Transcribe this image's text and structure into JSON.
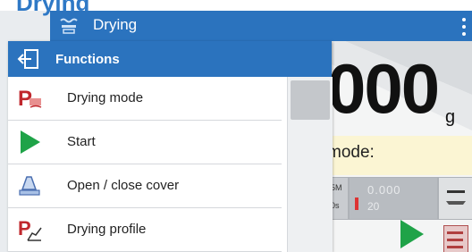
{
  "top_title": "Drying",
  "app_header": {
    "title": "Drying",
    "icon": "drying-icon"
  },
  "weighing": {
    "value": "000",
    "unit": "g",
    "mode_label": "mode:",
    "tile_small_1": "5M",
    "tile_small_2": "0s",
    "tile_value_1": "0.000",
    "tile_value_2": "20"
  },
  "menu": {
    "title": "Functions",
    "items": [
      {
        "label": "Drying mode",
        "icon": "drying-mode-icon"
      },
      {
        "label": "Start",
        "icon": "start-play-icon"
      },
      {
        "label": "Open / close cover",
        "icon": "cover-icon"
      },
      {
        "label": "Drying profile",
        "icon": "drying-profile-icon"
      }
    ]
  },
  "colors": {
    "header_blue": "#2b73be",
    "play_green": "#1fa348",
    "profile_red": "#c0272d"
  }
}
